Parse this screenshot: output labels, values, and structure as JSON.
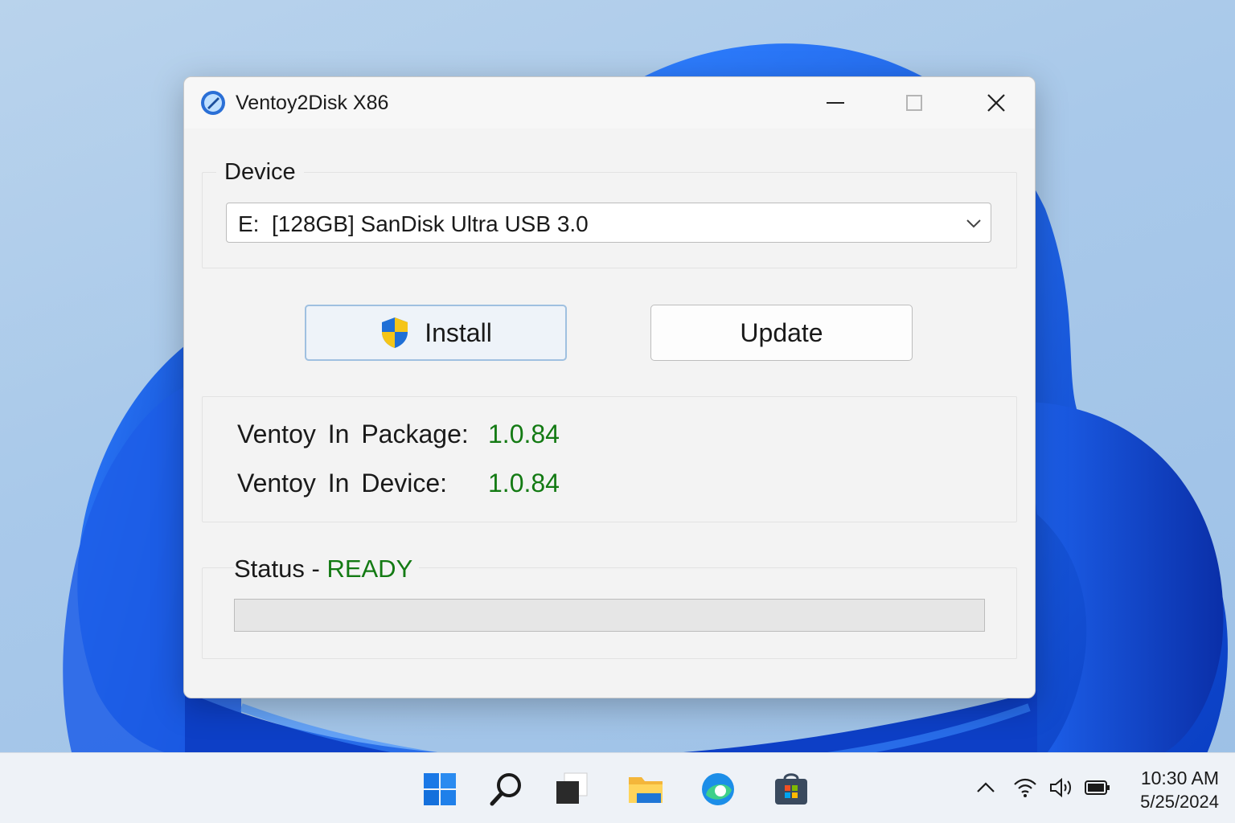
{
  "window": {
    "title": "Ventoy2Disk X86",
    "icon": "ventoy-app-icon"
  },
  "device": {
    "group_label": "Device",
    "selected": "E:  [128GB] SanDisk Ultra USB 3.0"
  },
  "buttons": {
    "install_label": "Install",
    "update_label": "Update"
  },
  "versions": {
    "package_label": "Ventoy In Package:",
    "package_value": "1.0.84",
    "device_label": "Ventoy In Device:",
    "device_value": "1.0.84"
  },
  "status": {
    "label": "Status - ",
    "value": "READY",
    "progress_percent": 0
  },
  "taskbar": {
    "icons": [
      "start-icon",
      "search-icon",
      "task-view-icon",
      "file-explorer-icon",
      "edge-icon",
      "store-icon"
    ],
    "tray": [
      "chevron-up-icon",
      "wifi-icon",
      "volume-icon",
      "battery-icon"
    ],
    "time": "10:30 AM",
    "date": "5/25/2024"
  },
  "colors": {
    "accent": "#137a13",
    "window_bg": "#f3f3f3",
    "install_border": "#9fc0e0"
  }
}
